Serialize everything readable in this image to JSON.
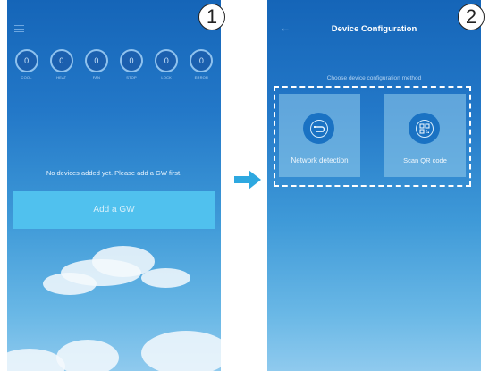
{
  "step_labels": [
    "1",
    "2"
  ],
  "screen1": {
    "status_items": [
      {
        "value": "0",
        "label": "COOL"
      },
      {
        "value": "0",
        "label": "HEAT"
      },
      {
        "value": "0",
        "label": "FAN"
      },
      {
        "value": "0",
        "label": "STOP"
      },
      {
        "value": "0",
        "label": "LOCK"
      },
      {
        "value": "0",
        "label": "ERROR"
      }
    ],
    "empty_message": "No devices added yet. Please add a GW first.",
    "add_button_label": "Add a GW"
  },
  "screen2": {
    "title": "Device Configuration",
    "subtitle": "Choose device configuration method",
    "methods": [
      {
        "label": "Network detection",
        "icon": "network-cable-icon"
      },
      {
        "label": "Scan QR code",
        "icon": "qr-code-icon"
      }
    ]
  },
  "colors": {
    "gradient_top": "#1565b8",
    "gradient_bottom": "#8fcaee",
    "add_button": "#50c1ee",
    "arrow": "#2ea8e0"
  }
}
